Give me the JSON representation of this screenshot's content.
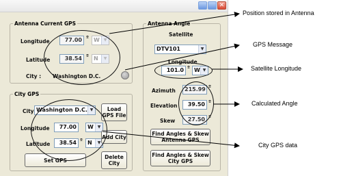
{
  "window": {
    "title_buttons": {
      "minimize": "minimize-icon",
      "maximize": "maximize-icon",
      "close": "close-icon"
    },
    "close_glyph": "✕"
  },
  "antenna_current": {
    "legend": "Antenna Current GPS",
    "longitude_label": "Longitude",
    "longitude_value": "77.00",
    "longitude_dir": "W",
    "latitude_label": "Latitude",
    "latitude_value": "38.54",
    "latitude_dir": "N",
    "degree_symbol": "º",
    "city_label": "City :",
    "city_value": "Washington D.C."
  },
  "city_gps": {
    "legend": "City GPS",
    "city_label": "City",
    "city_value": "Washington D.C.",
    "load_button": "Load\nGPS File",
    "longitude_label": "Longitude",
    "longitude_value": "77.00",
    "longitude_dir": "W",
    "latitude_label": "Latitude",
    "latitude_value": "38.54",
    "latitude_dir": "N",
    "add_button": "Add City",
    "set_button": "Set GPS",
    "delete_button": "Delete\nCity"
  },
  "antenna_angle": {
    "legend": "Antenna Angle",
    "satellite_label": "Satellite",
    "satellite_value": "DTV101",
    "longitude_label": "Longitude",
    "longitude_value": "101.0",
    "longitude_dir": "W",
    "azimuth_label": "Azimuth",
    "azimuth_value": "215.99",
    "elevation_label": "Elevation",
    "elevation_value": "39.50",
    "skew_label": "Skew",
    "skew_value": "27.50",
    "find_antenna_button": "Find Angles & Skew\nAntenna GPS",
    "find_city_button": "Find Angles & Skew\nCity GPS"
  },
  "annotations": {
    "position_stored": "Position stored in Antenna",
    "gps_message": "GPS Message",
    "satellite_longitude": "Satellite Longitude",
    "calculated_angle": "Calculated  Angle",
    "city_gps_data": "City GPS data"
  }
}
